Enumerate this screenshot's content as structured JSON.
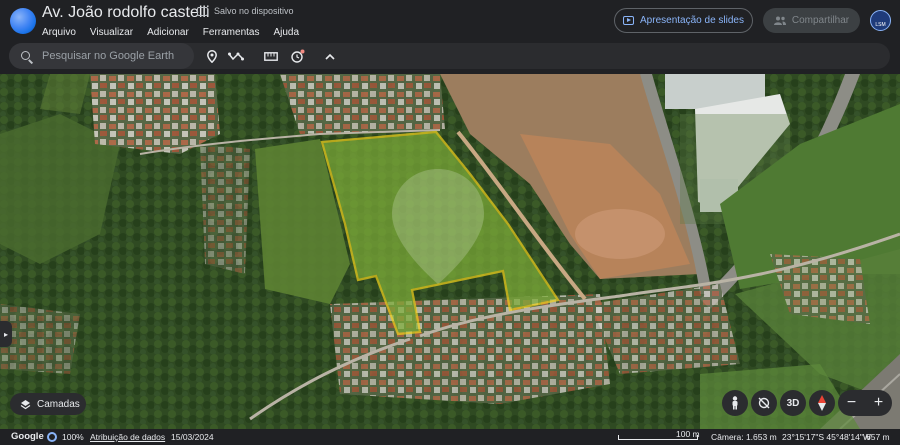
{
  "app": {
    "document_title": "Av. João rodolfo castelli",
    "saved_status": "Salvo no dispositivo",
    "menu": [
      "Arquivo",
      "Visualizar",
      "Adicionar",
      "Ferramentas",
      "Ajuda"
    ],
    "present_button": "Apresentação de slides",
    "share_button": "Compartilhar",
    "avatar_text": "LSM"
  },
  "toolbar": {
    "search_placeholder": "Pesquisar no Google Earth",
    "tools": [
      "pin-icon",
      "path-icon",
      "ruler-icon",
      "history-icon",
      "chevron-up-icon"
    ]
  },
  "map": {
    "layers_label": "Camadas",
    "controls": [
      "pegman-icon",
      "tilt-icon",
      "3D",
      "compass-icon"
    ],
    "zoom_out": "−",
    "zoom_in": "+",
    "boundary_color": "#f2d21b"
  },
  "footer": {
    "logo": "Google",
    "zoom_percent": "100%",
    "attribution": "Atribuição de dados",
    "date": "15/03/2024",
    "scale_label": "100 m",
    "camera": "Câmera: 1.653 m",
    "coordinates": "23°15'17\"S 45°48'14\"W",
    "elevation": "657 m"
  }
}
